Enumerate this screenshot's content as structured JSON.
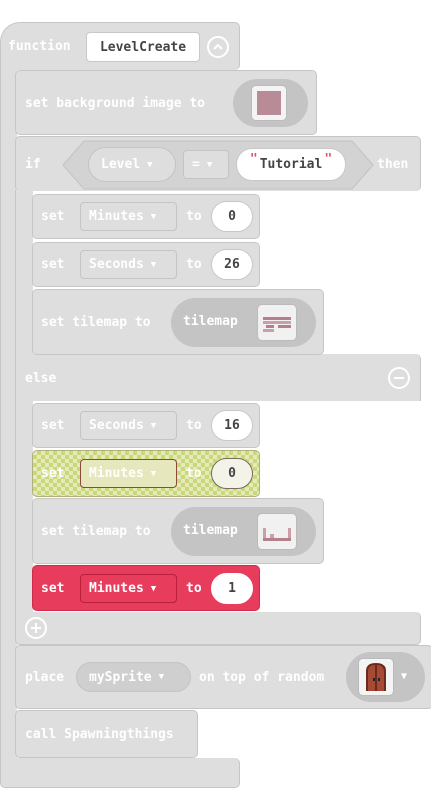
{
  "colors": {
    "block_gray": "#dedede",
    "dark_gray": "#c4c4c4",
    "highlight_yellow": "#e8e8ba",
    "highlight_green": "#aacd46",
    "error_red": "#e73c5c",
    "door_brown": "#6b2a1e"
  },
  "function_block": {
    "keyword": "function",
    "name": "LevelCreate",
    "collapse_icon": "chevron-up-circle-icon"
  },
  "background": {
    "label": "set background image to",
    "image_icon": "pink-square-image-icon"
  },
  "if_block": {
    "keyword": "if",
    "variable": "Level",
    "operator": "=",
    "open_quote": "\"",
    "value": "Tutorial",
    "close_quote": "\"",
    "then": "then"
  },
  "if_branch": {
    "set_minutes": {
      "set": "set",
      "variable": "Minutes",
      "to": "to",
      "value": "0"
    },
    "set_seconds": {
      "set": "set",
      "variable": "Seconds",
      "to": "to",
      "value": "26"
    },
    "set_tilemap": {
      "label": "set tilemap to",
      "reporter": "tilemap",
      "thumb_icon": "tilemap-preview-icon"
    }
  },
  "else_block": {
    "keyword": "else",
    "remove_icon": "minus-circle-icon"
  },
  "else_branch": {
    "set_seconds": {
      "set": "set",
      "variable": "Seconds",
      "to": "to",
      "value": "16"
    },
    "set_minutes": {
      "set": "set",
      "variable": "Minutes",
      "to": "to",
      "value": "0"
    },
    "set_tilemap": {
      "label": "set tilemap to",
      "reporter": "tilemap",
      "thumb_icon": "tilemap-preview-icon"
    },
    "set_minutes_2": {
      "set": "set",
      "variable": "Minutes",
      "to": "to",
      "value": "1"
    }
  },
  "add_icon": "plus-circle-icon",
  "place_block": {
    "label_before": "place",
    "sprite": "mySprite",
    "label_after": "on top of random",
    "tile_icon": "door-tile-icon"
  },
  "call_block": {
    "label": "call Spawningthings"
  }
}
